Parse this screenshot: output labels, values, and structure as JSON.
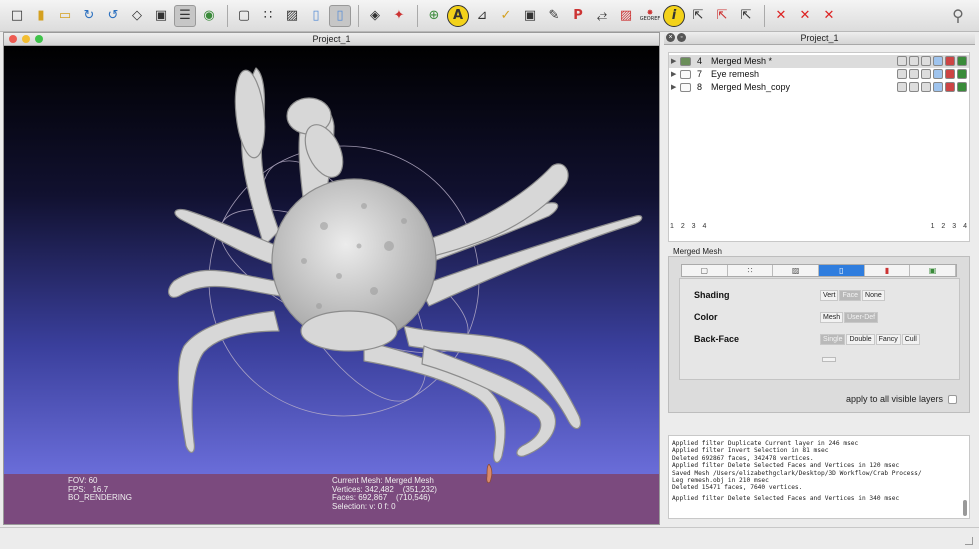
{
  "toolbar": {
    "icons": [
      "new-project-icon",
      "open-project-icon",
      "open-folder-icon",
      "reload-icon",
      "reload-all-icon",
      "save-icon",
      "snapshot-icon",
      "layers-icon",
      "globe-icon",
      "bounding-box-icon",
      "points-icon",
      "wireframe-icon",
      "flat-lines-icon",
      "flat-icon",
      "smooth-icon",
      "lighting-icon",
      "axes-icon",
      "trackball-icon",
      "annotation-icon",
      "measure-icon",
      "pick-icon",
      "camera-icon",
      "paint-icon",
      "point-picking-icon",
      "align-icon",
      "color-map-icon",
      "georef-icon",
      "info-icon",
      "select-vertices-icon",
      "select-faces-icon",
      "select-connected-icon",
      "delete-vertices-icon",
      "delete-faces-icon",
      "delete-all-icon",
      "search-icon"
    ],
    "annotation_glyph": "A",
    "info_glyph": "i",
    "georef_label": "GEOREF"
  },
  "viewer": {
    "title": "Project_1",
    "fov": "FOV: 60",
    "fps": "FPS:   16.7",
    "rendering": "BO_RENDERING",
    "current_mesh": "Current Mesh: Merged Mesh",
    "vertices": "Vertices: 342,482    (351,232)",
    "faces": "Faces: 692,867    (710,546)",
    "selection": "Selection: v: 0 f: 0"
  },
  "panel": {
    "title": "Project_1",
    "layers": [
      {
        "id": "4",
        "name": "Merged Mesh *",
        "selected": true
      },
      {
        "id": "7",
        "name": "Eye remesh",
        "selected": false
      },
      {
        "id": "8",
        "name": "Merged Mesh_copy",
        "selected": false
      }
    ],
    "pager_left": "1 2 3 4",
    "pager_right": "1 2 3 4",
    "props_label": "Merged Mesh",
    "shading_label": "Shading",
    "shading_opts": [
      "Vert",
      "Face",
      "None"
    ],
    "color_label": "Color",
    "color_opts": [
      "Mesh",
      "User-Def"
    ],
    "backface_label": "Back-Face",
    "backface_opts": [
      "Single",
      "Double",
      "Fancy",
      "Cull"
    ],
    "apply_label": "apply to all visible layers",
    "log": [
      "Applied filter Duplicate Current layer in 246 msec",
      "Applied filter Invert Selection in 81 msec",
      "Deleted 692867 faces, 342478 vertices.",
      "Applied filter Delete Selected Faces and Vertices in 120 msec",
      "Saved Mesh /Users/elizabethgclark/Desktop/3D Workflow/Crab Process/",
      "Leg remesh.obj in 210 msec",
      "Deleted 15471 faces, 7640 vertices.",
      "",
      "Applied filter Delete Selected Faces and Vertices in 340 msec"
    ]
  },
  "colors": {
    "accent": "#2f7dde",
    "floor": "#7b4a7e",
    "mesh": "#d9d9d9"
  }
}
